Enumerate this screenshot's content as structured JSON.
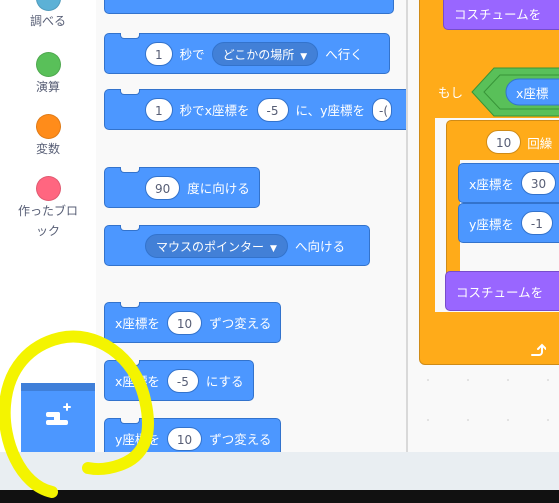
{
  "categories": [
    {
      "label": "調べる",
      "color": "#5cb1d6"
    },
    {
      "label": "演算",
      "color": "#59c059"
    },
    {
      "label": "変数",
      "color": "#ff8c1a"
    },
    {
      "label": "作ったブロ",
      "label2": "ック",
      "color": "#ff6680"
    }
  ],
  "palette": {
    "glide_random": {
      "num": "1",
      "t1": "秒で",
      "dropdown": "どこかの場所",
      "t2": "へ行く"
    },
    "glide_xy": {
      "num": "1",
      "t1": "秒でx座標を",
      "x": "-5",
      "t2": "に、y座標を",
      "y": "-(cut)"
    },
    "point_direction": {
      "num": "90",
      "t1": "度に向ける"
    },
    "point_towards": {
      "dropdown": "マウスのポインター",
      "t1": "へ向ける"
    },
    "change_x": {
      "t1": "x座標を",
      "num": "10",
      "t2": "ずつ変える"
    },
    "set_x": {
      "t1": "x座標を",
      "num": "-5",
      "t2": "にする"
    },
    "change_y": {
      "t1": "y座標を",
      "num": "10",
      "t2": "ずつ変える"
    }
  },
  "script": {
    "costume_top": "コスチュームを",
    "if_label": "もし",
    "cond_reporter": "x座標",
    "repeat_num": "10",
    "repeat_label": "回繰",
    "set_x_label": "x座標を",
    "set_x_num": "30",
    "set_y_label": "y座標を",
    "set_y_num": "-1",
    "costume_bottom": "コスチュームを"
  },
  "colors": {
    "motion": "#4c97ff",
    "control": "#ffab19",
    "operator": "#59c059",
    "looks": "#9966ff",
    "highlight": "#f4f400"
  }
}
